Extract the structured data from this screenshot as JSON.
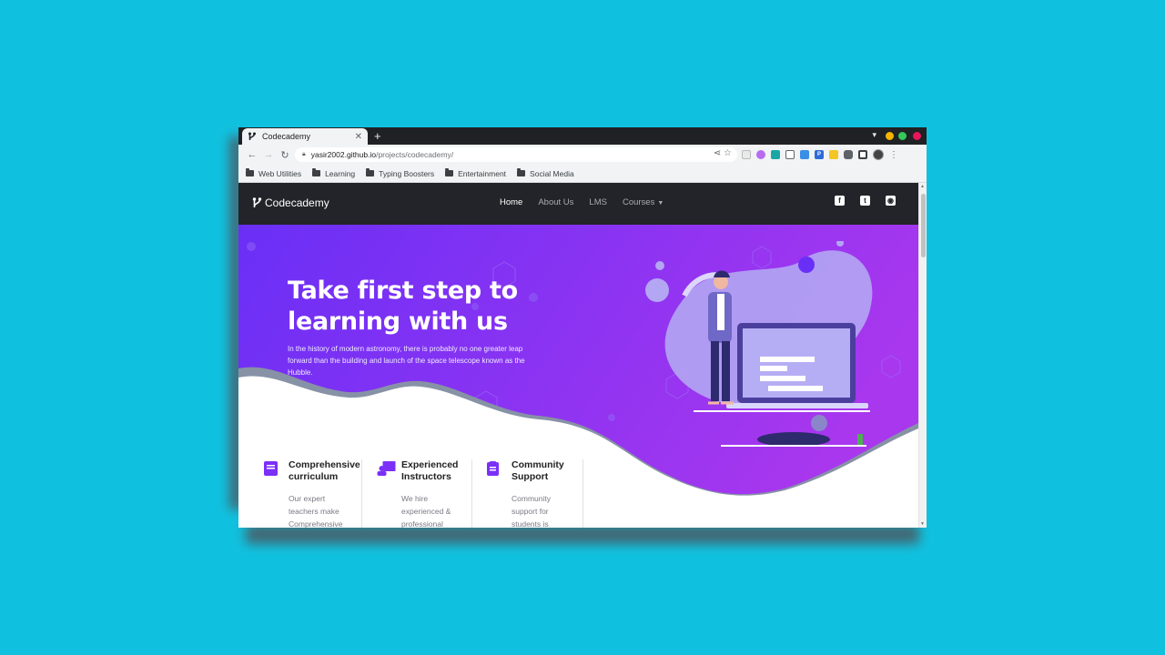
{
  "browser": {
    "tab_title": "Codecademy",
    "url_host": "yasir2002.github.io",
    "url_path": "/projects/codecademy/",
    "bookmarks": [
      {
        "label": "Web Utilities"
      },
      {
        "label": "Learning"
      },
      {
        "label": "Typing Boosters"
      },
      {
        "label": "Entertainment"
      },
      {
        "label": "Social Media"
      }
    ],
    "window_dot_colors": [
      "#f4b400",
      "#34c759",
      "#e8155a"
    ]
  },
  "site": {
    "brand": "Codecademy",
    "nav": [
      {
        "label": "Home",
        "active": true
      },
      {
        "label": "About Us"
      },
      {
        "label": "LMS"
      },
      {
        "label": "Courses"
      }
    ],
    "social": [
      {
        "icon": "facebook-icon"
      },
      {
        "icon": "twitter-icon"
      },
      {
        "icon": "github-icon"
      }
    ],
    "hero": {
      "title": "Take first step to learning with us",
      "text": "In the history of modern astronomy, there is probably no one greater leap forward than the building and launch of the space telescope known as the Hubble."
    },
    "features": [
      {
        "title": "Comprehensive curriculum",
        "text": "Our expert teachers make Comprehensive",
        "icon": "book-icon"
      },
      {
        "title": "Experienced Instructors",
        "text": "We hire experienced & professional",
        "icon": "teacher-icon"
      },
      {
        "title": "Community Support",
        "text": "Community support for students is",
        "icon": "support-icon"
      }
    ],
    "colors": {
      "accent_purple": "#7b2ff7",
      "nav_bg": "#222429",
      "background": "#10c1df"
    }
  }
}
